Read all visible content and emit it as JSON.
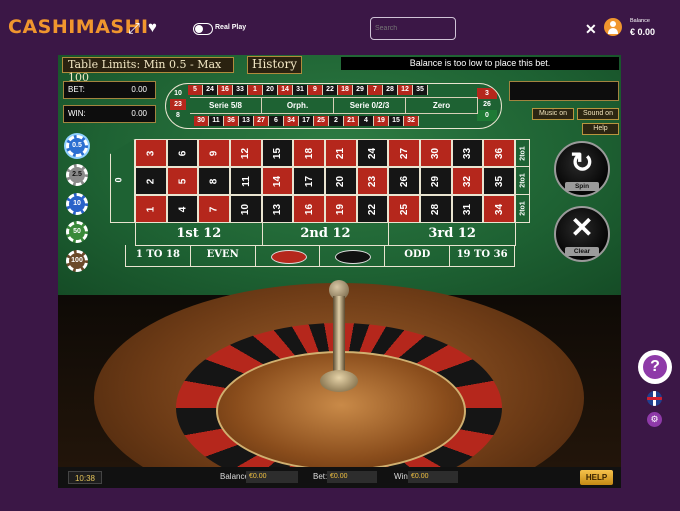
{
  "header": {
    "logo": "CASHIMASHI",
    "real_play_label": "Real Play",
    "search_placeholder": "Search",
    "balance_label": "Balance",
    "balance_value": "€ 0.00"
  },
  "game": {
    "table_limits": "Table Limits: Min 0.5 - Max 100",
    "history_label": "History",
    "message": "Balance is too low to place this bet.",
    "bet_label": "BET:",
    "bet_value": "0.00",
    "win_label": "WIN:",
    "win_value": "0.00",
    "music_label": "Music on",
    "sound_label": "Sound on",
    "help_small_label": "Help",
    "spin_label": "Spin",
    "clear_label": "Clear",
    "chips": [
      "0.5",
      "2.5",
      "10",
      "50",
      "100"
    ],
    "racetrack": {
      "top": [
        "5",
        "24",
        "16",
        "33",
        "1",
        "20",
        "14",
        "31",
        "9",
        "22",
        "18",
        "29",
        "7",
        "28",
        "12",
        "35"
      ],
      "bottom": [
        "30",
        "11",
        "36",
        "13",
        "27",
        "6",
        "34",
        "17",
        "25",
        "2",
        "21",
        "4",
        "19",
        "15",
        "32"
      ],
      "left": [
        "10",
        "23",
        "8"
      ],
      "right": [
        "3",
        "26",
        "0"
      ],
      "sections": [
        "Serie 5/8",
        "Orph.",
        "Serie 0/2/3",
        "Zero"
      ]
    },
    "zero_label": "0",
    "rows": [
      [
        "3",
        "6",
        "9",
        "12",
        "15",
        "18",
        "21",
        "24",
        "27",
        "30",
        "33",
        "36"
      ],
      [
        "2",
        "5",
        "8",
        "11",
        "14",
        "17",
        "20",
        "23",
        "26",
        "29",
        "32",
        "35"
      ],
      [
        "1",
        "4",
        "7",
        "10",
        "13",
        "16",
        "19",
        "22",
        "25",
        "28",
        "31",
        "34"
      ]
    ],
    "column_bets": [
      "2to1",
      "2to1",
      "2to1"
    ],
    "dozens": [
      "1st 12",
      "2nd 12",
      "3rd 12"
    ],
    "outside": [
      "1 TO 18",
      "EVEN",
      "",
      "",
      "ODD",
      "19 TO 36"
    ],
    "status": {
      "clock": "10:38",
      "balance_label": "Balance:",
      "balance_value": "€0.00",
      "bet_label": "Bet:",
      "bet_value": "€0.00",
      "win_label": "Win:",
      "win_value": "€0.00",
      "help_label": "HELP"
    }
  },
  "colors": {
    "background": "#3b1746",
    "logo": "#f0962e",
    "felt": "#1e6233",
    "red": "#b5271c",
    "black": "#151515",
    "help_purple": "#8e3aa8"
  },
  "icons": [
    "expand-icon",
    "heart-icon",
    "close-icon",
    "user-icon",
    "question-icon",
    "flag-icon",
    "settings-icon",
    "spin-icon",
    "clear-icon"
  ]
}
